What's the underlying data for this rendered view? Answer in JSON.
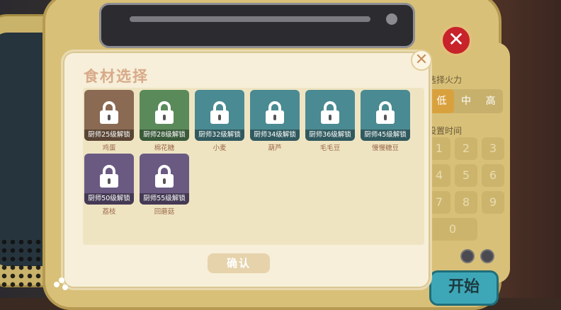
{
  "background": {
    "fire_label": "选择火力",
    "fire_options": [
      "低",
      "中",
      "高"
    ],
    "fire_selected": "低",
    "time_label": "设置时间",
    "keypad": [
      "1",
      "2",
      "3",
      "4",
      "5",
      "6",
      "7",
      "8",
      "9",
      "0"
    ],
    "start_label": "开始",
    "close_label": "✕"
  },
  "dialog": {
    "title": "食材选择",
    "close_label": "✕",
    "confirm_label": "确认"
  },
  "ingredients": [
    {
      "name": "鸡蛋",
      "unlock": "厨师25级解锁",
      "bg": "#8a6a52",
      "locked": true
    },
    {
      "name": "棉花糖",
      "unlock": "厨师28级解锁",
      "bg": "#5a8a5a",
      "locked": true
    },
    {
      "name": "小麦",
      "unlock": "厨师32级解锁",
      "bg": "#4a8a92",
      "locked": true
    },
    {
      "name": "葫芦",
      "unlock": "厨师34级解锁",
      "bg": "#4a8a92",
      "locked": true
    },
    {
      "name": "毛毛豆",
      "unlock": "厨师36级解锁",
      "bg": "#4a8a92",
      "locked": true
    },
    {
      "name": "慢慢糖豆",
      "unlock": "厨师45级解锁",
      "bg": "#4a8a92",
      "locked": true
    },
    {
      "name": "荔枝",
      "unlock": "厨师50级解锁",
      "bg": "#6a5a82",
      "locked": true
    },
    {
      "name": "回蘑菇",
      "unlock": "厨师55级解锁",
      "bg": "#6a5a82",
      "locked": true
    }
  ]
}
